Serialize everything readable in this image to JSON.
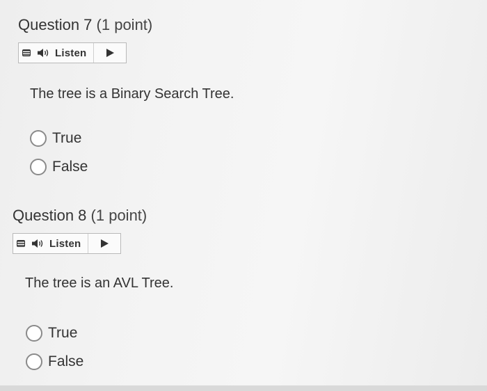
{
  "questions": [
    {
      "title": "Question 7",
      "points": "(1 point)",
      "listen_label": "Listen",
      "text": "The tree is a Binary Search Tree.",
      "options": [
        {
          "label": "True",
          "selected": false
        },
        {
          "label": "False",
          "selected": false
        }
      ]
    },
    {
      "title": "Question 8",
      "points": "(1 point)",
      "listen_label": "Listen",
      "text": "The tree is an AVL Tree.",
      "options": [
        {
          "label": "True",
          "selected": false
        },
        {
          "label": "False",
          "selected": false
        }
      ]
    }
  ],
  "icons": {
    "menu": "menu-icon",
    "speaker": "speaker-icon",
    "play": "play-icon"
  }
}
